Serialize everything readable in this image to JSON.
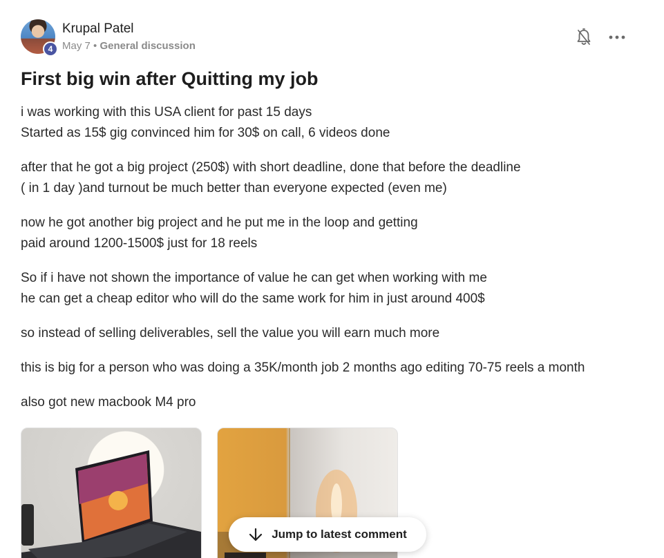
{
  "post": {
    "author": {
      "name": "Krupal Patel",
      "level": "4"
    },
    "date": "May 7",
    "separator": "•",
    "category": "General discussion",
    "title": "First big win after Quitting my job",
    "paragraphs": [
      [
        "i was working with this USA client for past 15 days",
        "Started as 15$ gig convinced him for 30$ on call, 6 videos done"
      ],
      [
        "after that he got a big project (250$) with short deadline, done that before the deadline",
        "( in 1 day )and turnout be much better than everyone expected (even me)"
      ],
      [
        "now he got another big project and he put me in the loop and getting",
        "paid around 1200-1500$ just for 18 reels"
      ],
      [
        "So if i have not shown the importance of value he can get when working with me",
        "he can get a cheap editor who will do the same work for him in just around 400$"
      ],
      [
        "so instead of selling deliverables, sell the value you will earn much more"
      ],
      [
        "this is big for a person who was doing a 35K/month job 2 months ago editing 70-75 reels a month"
      ],
      [
        "also got new macbook M4 pro"
      ]
    ],
    "images": [
      {
        "icon": "laptop-photo"
      },
      {
        "icon": "room-photo"
      }
    ]
  },
  "actions": {
    "notify_icon": "bell-off-icon",
    "more_icon": "more-horizontal-icon"
  },
  "jump_button": {
    "label": "Jump to latest comment",
    "icon": "arrow-down-icon"
  },
  "colors": {
    "badge": "#4a55a2",
    "text": "#2a2a2a",
    "muted": "#8a8a8a"
  }
}
